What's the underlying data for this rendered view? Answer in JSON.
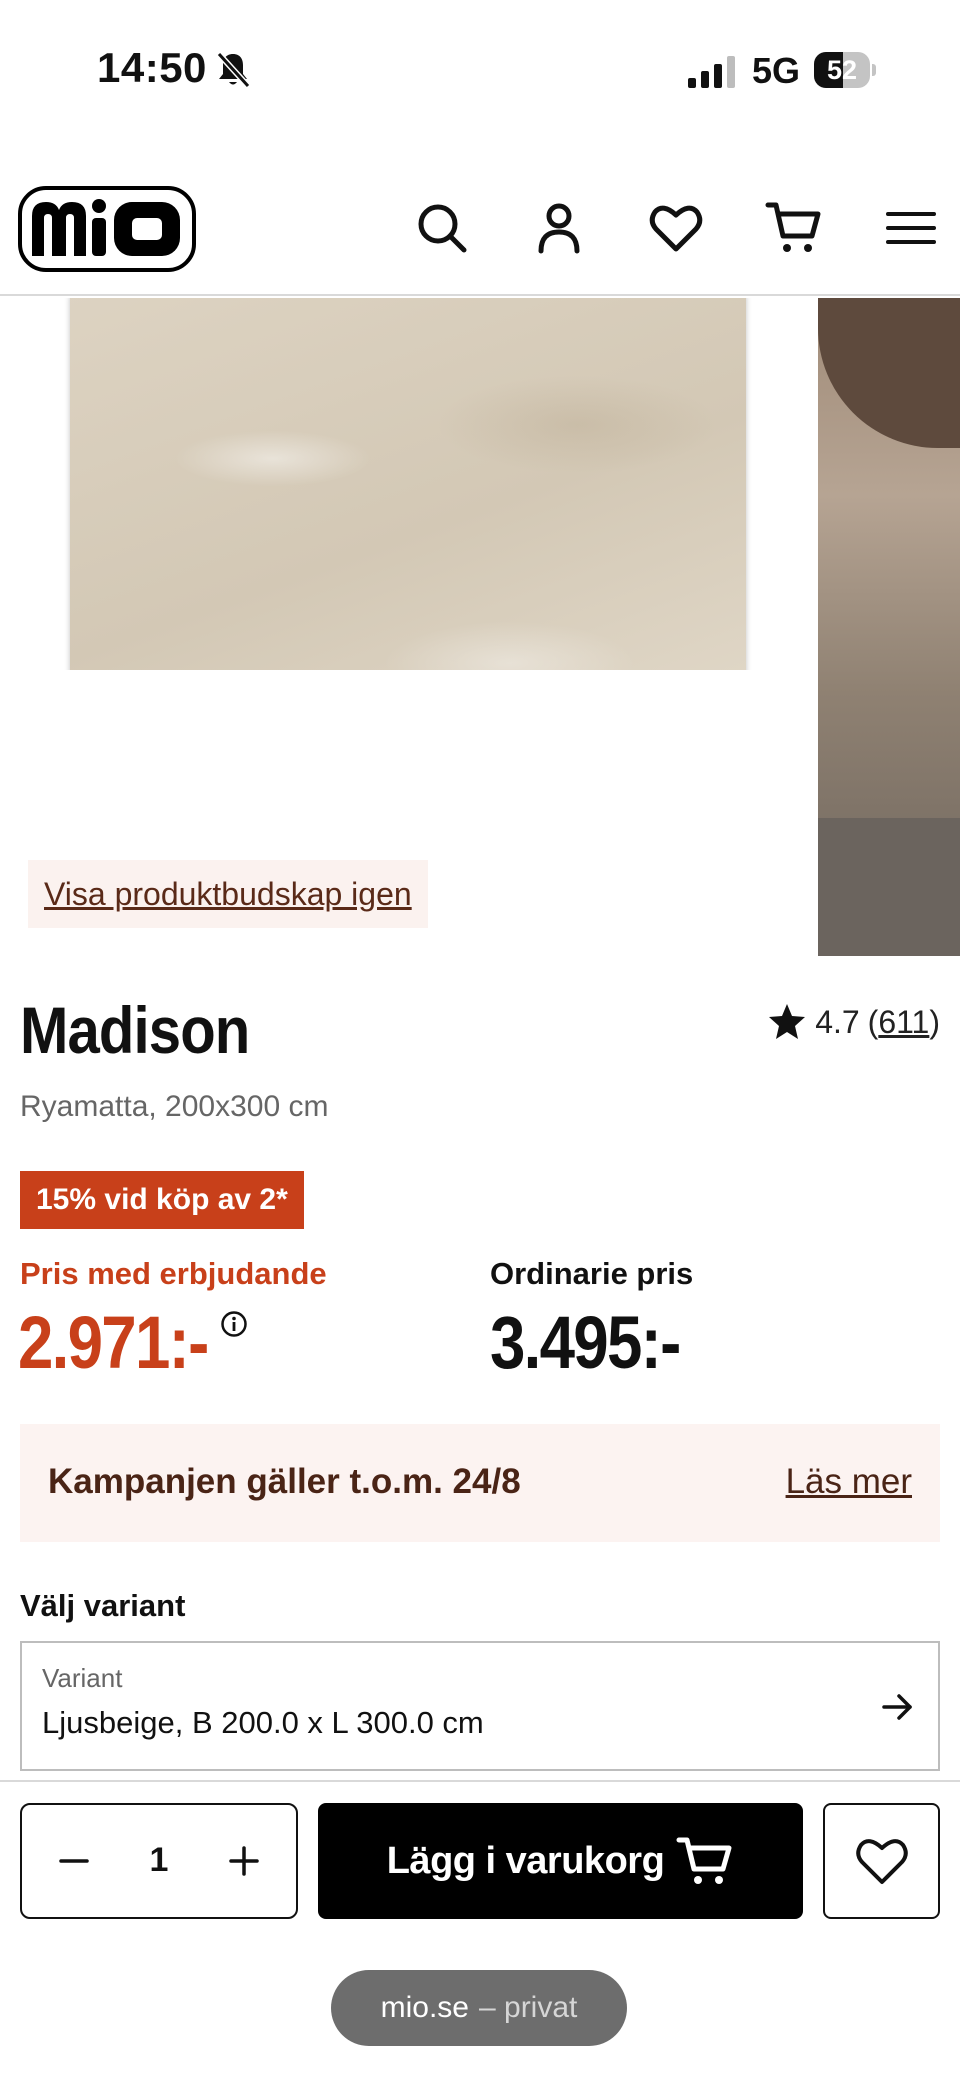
{
  "status_bar": {
    "time": "14:50",
    "network": "5G",
    "battery_percent": 52,
    "battery_label": "52",
    "silent_icon": "bell-slash-icon",
    "signal_icon": "cellular-signal-icon"
  },
  "header": {
    "logo_text": "mio",
    "icons": [
      "search-icon",
      "account-icon",
      "heart-icon",
      "cart-icon",
      "menu-icon"
    ]
  },
  "gallery": {
    "view_pitch_link": "Visa produktbudskap igen"
  },
  "product": {
    "title": "Madison",
    "subtitle": "Ryamatta, 200x300 cm",
    "rating": "4.7",
    "rating_open": "(",
    "rating_count": "611",
    "rating_close": ")"
  },
  "promo": {
    "badge": "15% vid köp av 2*",
    "offer_label": "Pris med erbjudande",
    "offer_price": "2.971:-",
    "regular_label": "Ordinarie pris",
    "regular_price": "3.495:-",
    "accent_color": "#c8401a"
  },
  "campaign": {
    "text": "Kampanjen gäller t.o.m. 24/8",
    "link": "Läs mer"
  },
  "variant": {
    "heading": "Välj variant",
    "label": "Variant",
    "value": "Ljusbeige, B 200.0 x L 300.0 cm"
  },
  "cart": {
    "quantity": "1",
    "add_label": "Lägg i varukorg"
  },
  "browser": {
    "domain": "mio.se",
    "mode": "– privat"
  }
}
